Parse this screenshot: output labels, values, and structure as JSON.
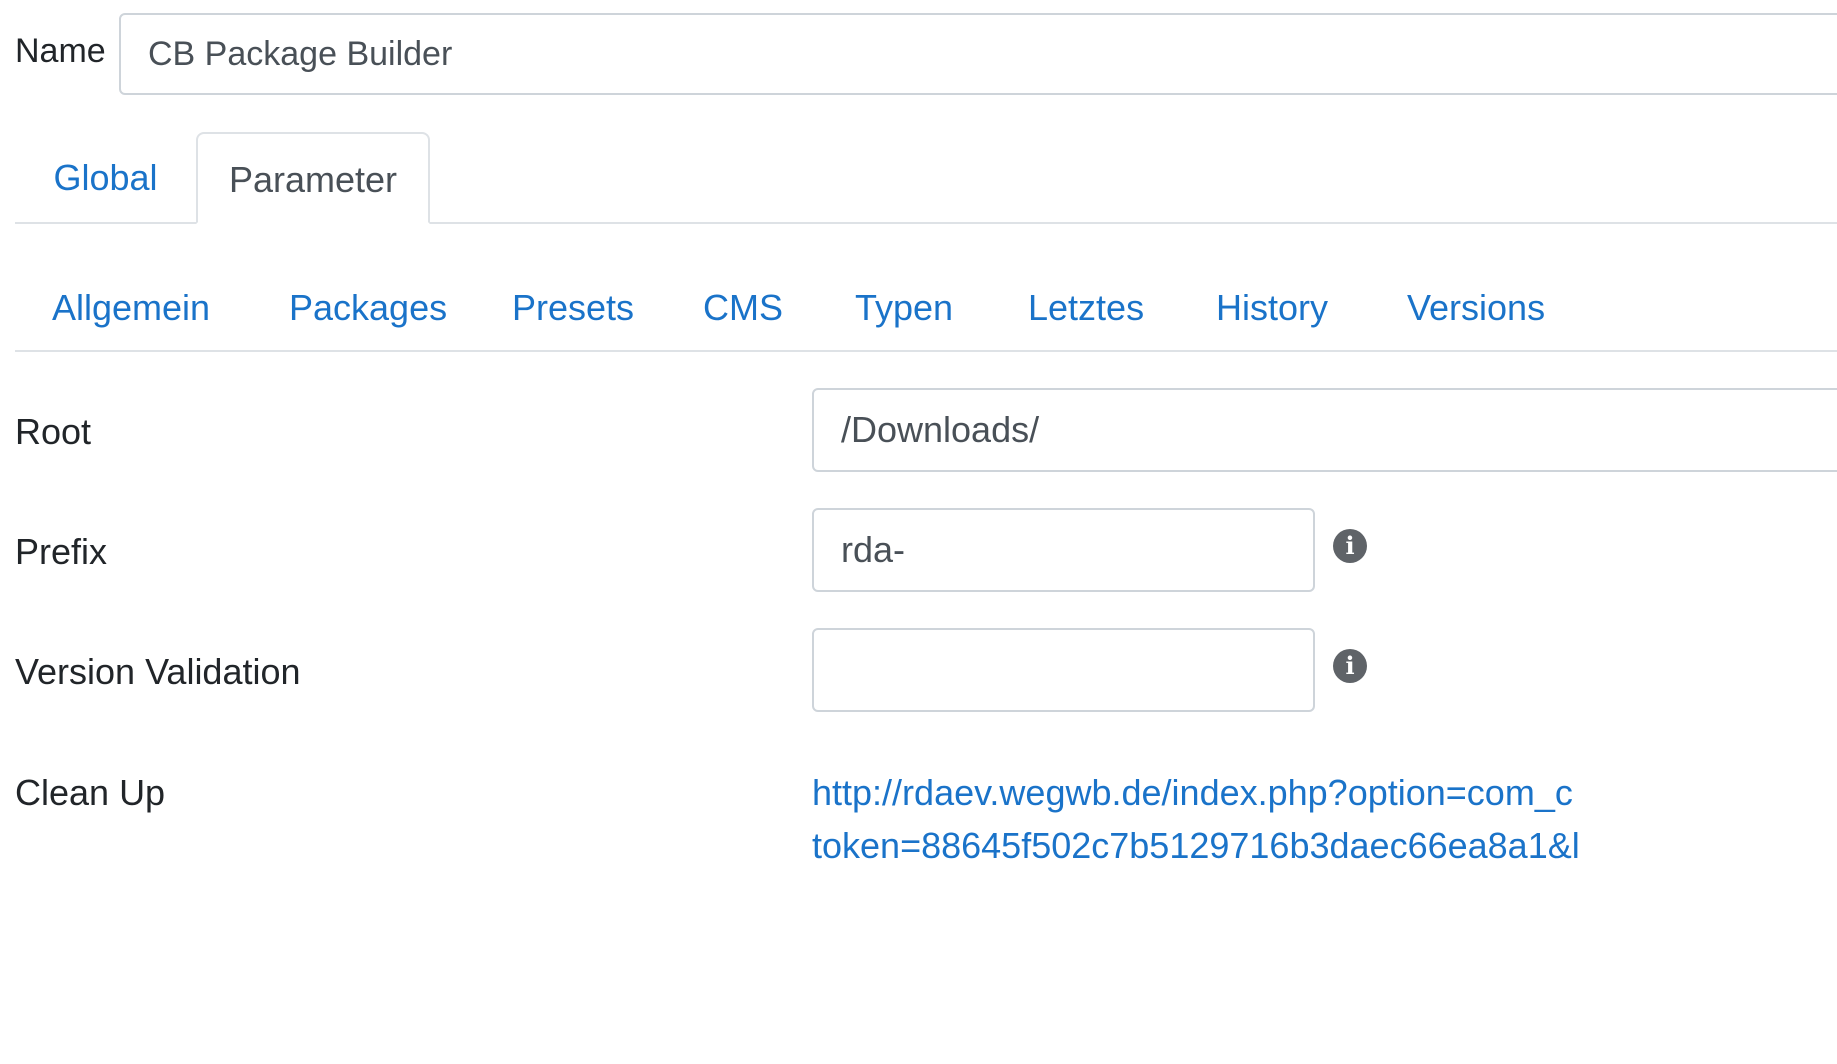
{
  "name": {
    "label": "Name",
    "value": "CB Package Builder"
  },
  "primary_tabs": [
    {
      "label": "Global",
      "active": false
    },
    {
      "label": "Parameter",
      "active": true
    }
  ],
  "secondary_tabs": [
    {
      "label": "Allgemein"
    },
    {
      "label": "Packages"
    },
    {
      "label": "Presets"
    },
    {
      "label": "CMS"
    },
    {
      "label": "Typen"
    },
    {
      "label": "Letztes"
    },
    {
      "label": "History"
    },
    {
      "label": "Versions"
    }
  ],
  "form": {
    "root": {
      "label": "Root",
      "value": "/Downloads/"
    },
    "prefix": {
      "label": "Prefix",
      "value": "rda-",
      "info_icon": "info-icon"
    },
    "version_validation": {
      "label": "Version Validation",
      "value": "",
      "info_icon": "info-icon"
    },
    "clean_up": {
      "label": "Clean Up",
      "link_line1": "http://rdaev.wegwb.de/index.php?option=com_c",
      "link_line2": "token=88645f502c7b5129716b3daec66ea8a1&l"
    }
  },
  "colors": {
    "link": "#1a73c9",
    "border": "#ced4da",
    "tab_border": "#dee2e6",
    "text": "#212529",
    "icon": "#5f6368"
  }
}
